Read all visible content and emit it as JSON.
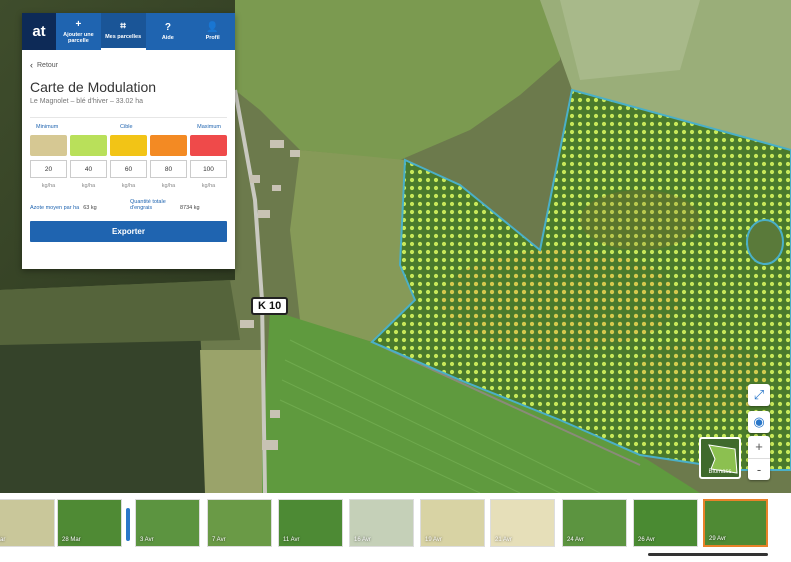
{
  "app": {
    "logo": "at"
  },
  "nav": {
    "items": [
      {
        "label": "Ajouter une parcelle",
        "icon": "plus-icon",
        "glyph": "+"
      },
      {
        "label": "Mes parcelles",
        "icon": "parcels-icon",
        "glyph": "⌗",
        "active": true
      },
      {
        "label": "Aide",
        "icon": "help-icon",
        "glyph": "?"
      },
      {
        "label": "Profil",
        "icon": "user-icon",
        "glyph": "👤"
      }
    ]
  },
  "panel": {
    "back_label": "Retour",
    "title": "Carte de Modulation",
    "subtitle": "Le Magnolet – blé d'hiver – 33.02 ha",
    "scale_labels": {
      "min": "Minimum",
      "target": "Cible",
      "max": "Maximum"
    },
    "levels": [
      {
        "value": "20",
        "unit": "kg/ha",
        "color": "#d6c893"
      },
      {
        "value": "40",
        "unit": "kg/ha",
        "color": "#b9e05a"
      },
      {
        "value": "60",
        "unit": "kg/ha",
        "color": "#f2c416"
      },
      {
        "value": "80",
        "unit": "kg/ha",
        "color": "#f38a23"
      },
      {
        "value": "100",
        "unit": "kg/ha",
        "color": "#ef4a4a"
      }
    ],
    "stats": {
      "avg_label": "Azote moyen par ha",
      "avg_value": "63 kg",
      "total_label": "Quantité totale d'engrais",
      "total_value": "8734 kg"
    },
    "export_label": "Exporter"
  },
  "map": {
    "road_label": "K 10",
    "layer_label": "Biomass",
    "controls": {
      "fullscreen_icon": "expand-icon",
      "visibility_icon": "eye-slash-icon",
      "zoom_in": "+",
      "zoom_out": "-"
    }
  },
  "timeline": {
    "dates": [
      "Mar",
      "28 Mar",
      "3 Avr",
      "7 Avr",
      "11 Avr",
      "16 Avr",
      "19 Avr",
      "21 Avr",
      "24 Avr",
      "26 Avr",
      "29 Avr"
    ],
    "selected_index": 10
  }
}
